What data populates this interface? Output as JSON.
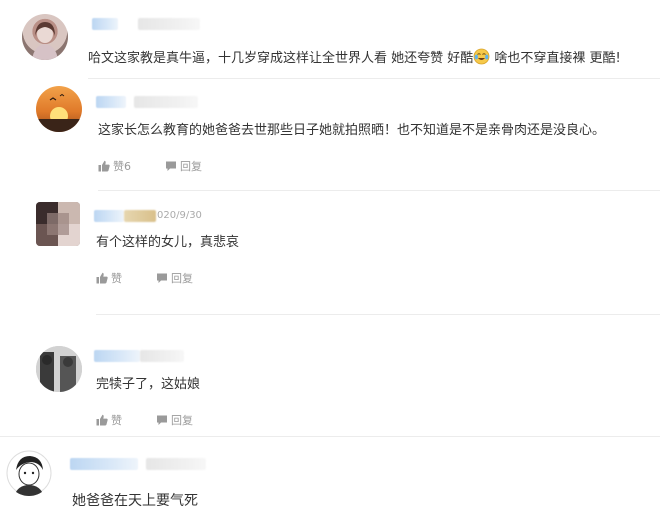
{
  "comments": [
    {
      "text": "哈文这家教是真牛逼，十几岁穿成这样让全世界人看 她还夸赞 好酷",
      "text_after_emoji": " 啥也不穿直接裸 更酷!",
      "emoji_icon": "crying-laughing-emoji-icon"
    },
    {
      "text": "这家长怎么教育的她爸爸去世那些日子她就拍照晒！也不知道是不是亲骨肉还是没良心。",
      "like_label": "赞6",
      "reply_label": "回复"
    },
    {
      "date": "020/9/30",
      "text": "有个这样的女儿，真悲哀",
      "like_label": "赞",
      "reply_label": "回复"
    },
    {
      "text": "完犊子了，这姑娘",
      "like_label": "赞",
      "reply_label": "回复"
    },
    {
      "text": "她爸爸在天上要气死"
    }
  ],
  "colors": {
    "name_blur": "#cfe2f6",
    "meta_text": "#9a9a9a",
    "divider": "#ececec"
  }
}
